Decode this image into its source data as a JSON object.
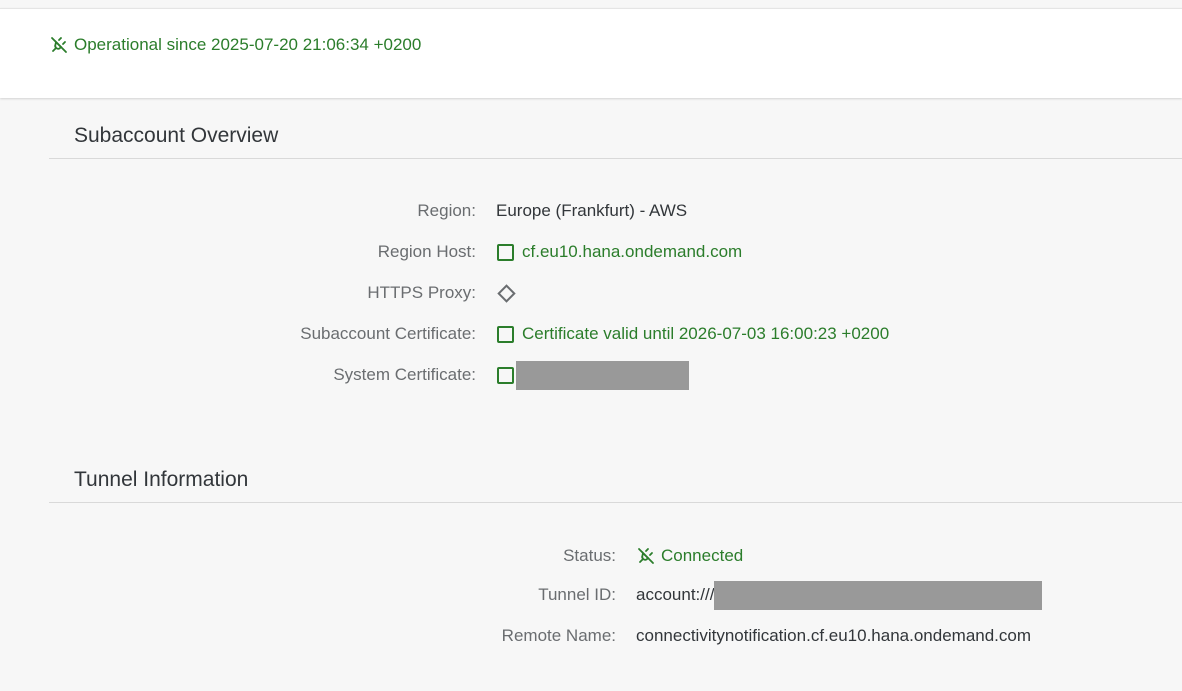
{
  "header": {
    "status_text": "Operational since 2025-07-20 21:06:34 +0200"
  },
  "overview": {
    "title": "Subaccount Overview",
    "rows": [
      {
        "label": "Region:",
        "value": "Europe (Frankfurt) - AWS"
      },
      {
        "label": "Region Host:",
        "value": "cf.eu10.hana.ondemand.com"
      },
      {
        "label": "HTTPS Proxy:",
        "value": ""
      },
      {
        "label": "Subaccount Certificate:",
        "value": "Certificate valid until 2026-07-03 16:00:23 +0200"
      },
      {
        "label": "System Certificate:",
        "value": ""
      }
    ]
  },
  "tunnel": {
    "title": "Tunnel Information",
    "rows": [
      {
        "label": "Status:",
        "value": "Connected"
      },
      {
        "label": "Tunnel ID:",
        "value": "account:///"
      },
      {
        "label": "Remote Name:",
        "value": "connectivitynotification.cf.eu10.hana.ondemand.com"
      }
    ]
  },
  "colors": {
    "success": "#2b7d2b",
    "label": "#6a6d70",
    "text": "#32363a",
    "redaction": "#999999"
  },
  "icons": {
    "status": "disconnected-plug-icon",
    "host": "square-status-icon",
    "proxy": "diamond-icon",
    "certificate": "square-status-icon"
  }
}
